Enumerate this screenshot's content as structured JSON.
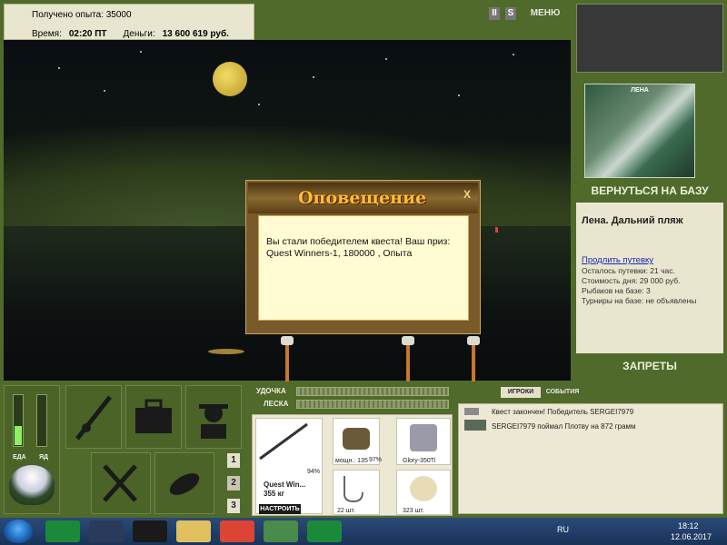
{
  "info": {
    "exp_label": "Получено опыта: 35000",
    "time_label": "Время:",
    "time_value": "02:20 ПТ",
    "money_label": "Деньги:",
    "money_value": "13 600 619 руб."
  },
  "top_controls": {
    "pause": "II",
    "sound": "S",
    "menu": "МЕНЮ"
  },
  "right_panel": {
    "base_image_caption": "ЛЕНА",
    "back_button": "ВЕРНУТЬСЯ НА БАЗУ",
    "location": "Лена. Дальний пляж",
    "extend_link": "Продлить путевку",
    "lines": [
      "Осталось путевки: 21 час.",
      "Стоимость дня: 29 000 руб.",
      "Рыбаков на базе: 3",
      "Турниры на базе: не объявлены"
    ],
    "bans_button": "ЗАПРЕТЫ"
  },
  "dialog": {
    "title": "Оповещение",
    "close": "X",
    "message": "Вы стали победителем квеста! Ваш приз: Quest Winners-1, 180000 , Опыта"
  },
  "bottom": {
    "food_label": "ЕДА",
    "poison_label": "ЯД",
    "food_level": 0.38,
    "poison_level": 0.0,
    "page_numbers": [
      "1",
      "2",
      "3"
    ],
    "rod_label": "УДОЧКА",
    "line_label": "ЛЕСКА",
    "tackle": {
      "rod_name": "Quest Win...",
      "rod_weight": "355 кг",
      "rod_percent": "94%",
      "setup_button": "НАСТРОИТЬ",
      "reel_power": "мощн.: 135",
      "reel_percent": "97%",
      "line_name": "Glory-350Ti",
      "hooks_count": "22 шт.",
      "bait_count": "323 шт."
    },
    "tabs": {
      "players": "ИГРОКИ",
      "events": "СОБЫТИЯ"
    },
    "events": [
      "Квест закончен! Победитель SERGEI7979",
      "SERGEI7979 поймал Плотву на 872 грамм"
    ]
  },
  "taskbar": {
    "lang": "RU",
    "time": "18:12",
    "date": "12.06.2017"
  }
}
